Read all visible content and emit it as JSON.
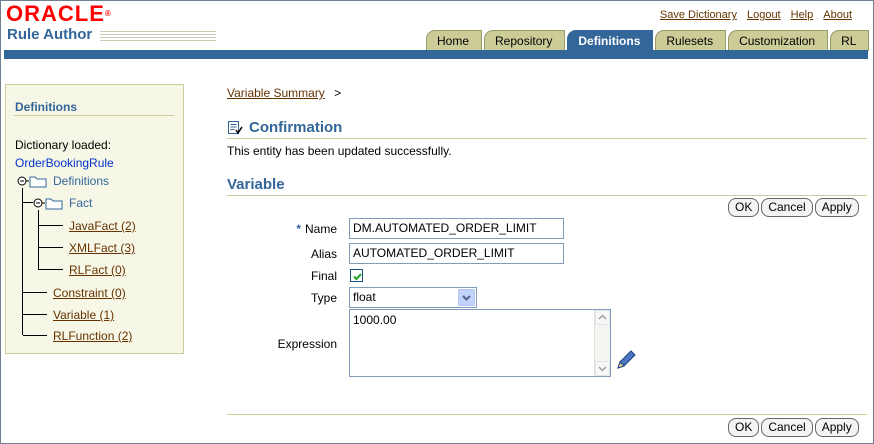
{
  "header": {
    "logo_text": "ORACLE",
    "product_name": "Rule Author",
    "global_links": [
      "Save Dictionary",
      "Logout",
      "Help",
      "About"
    ]
  },
  "tabs": [
    {
      "label": "Home",
      "active": false
    },
    {
      "label": "Repository",
      "active": false
    },
    {
      "label": "Definitions",
      "active": true
    },
    {
      "label": "Rulesets",
      "active": false
    },
    {
      "label": "Customization",
      "active": false
    },
    {
      "label": "RL",
      "active": false
    }
  ],
  "sidebar": {
    "title": "Definitions",
    "dictionary_label": "Dictionary loaded:",
    "dictionary_name": "OrderBookingRule",
    "tree": {
      "root": "Definitions",
      "fact": "Fact",
      "java_fact": "JavaFact (2)",
      "xml_fact": "XMLFact (3)",
      "rl_fact": "RLFact (0)",
      "constraint": "Constraint (0)",
      "variable": "Variable (1)",
      "rl_function": "RLFunction (2)"
    }
  },
  "breadcrumb": {
    "link": "Variable Summary",
    "separator": ">"
  },
  "confirmation": {
    "title": "Confirmation",
    "message": "This entity has been updated successfully."
  },
  "variable_section": {
    "title": "Variable"
  },
  "buttons": {
    "ok": "OK",
    "cancel": "Cancel",
    "apply": "Apply"
  },
  "form": {
    "required_marker": "*",
    "name_label": "Name",
    "name_value": "DM.AUTOMATED_ORDER_LIMIT",
    "alias_label": "Alias",
    "alias_value": "AUTOMATED_ORDER_LIMIT",
    "final_label": "Final",
    "final_checked": true,
    "type_label": "Type",
    "type_value": "float",
    "expression_label": "Expression",
    "expression_value": "1000.00"
  },
  "colors": {
    "brand_red": "#ff0000",
    "accent_blue": "#336699",
    "tab_tan": "#cccc99",
    "link_brown": "#663300"
  }
}
